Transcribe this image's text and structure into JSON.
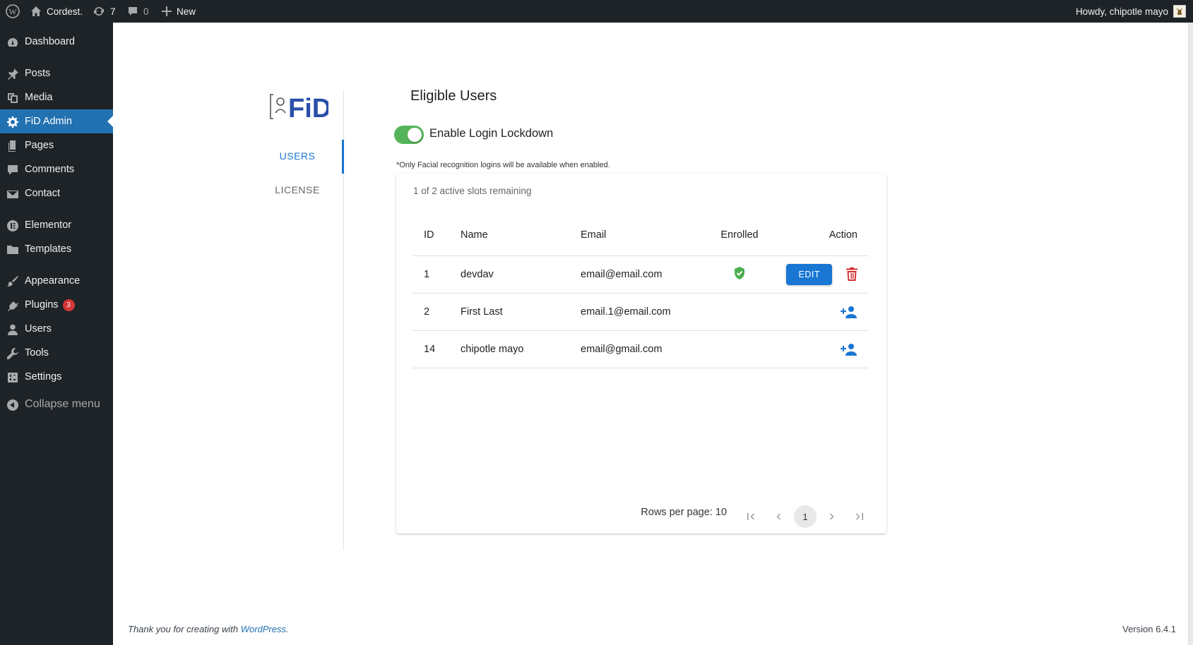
{
  "adminbar": {
    "site_name": "Cordest.",
    "updates_count": "7",
    "comments_count": "0",
    "new_label": "New",
    "greeting": "Howdy, chipotle mayo"
  },
  "sidebar": {
    "items": [
      {
        "label": "Dashboard",
        "icon": "dashboard-icon"
      },
      {
        "label": "Posts",
        "icon": "pin-icon"
      },
      {
        "label": "Media",
        "icon": "media-icon"
      },
      {
        "label": "FiD Admin",
        "icon": "gear-icon",
        "active": true
      },
      {
        "label": "Pages",
        "icon": "page-icon"
      },
      {
        "label": "Comments",
        "icon": "comment-icon"
      },
      {
        "label": "Contact",
        "icon": "mail-icon"
      },
      {
        "label": "Elementor",
        "icon": "elementor-icon"
      },
      {
        "label": "Templates",
        "icon": "folder-icon"
      },
      {
        "label": "Appearance",
        "icon": "brush-icon"
      },
      {
        "label": "Plugins",
        "icon": "plug-icon",
        "badge": "3"
      },
      {
        "label": "Users",
        "icon": "user-icon"
      },
      {
        "label": "Tools",
        "icon": "wrench-icon"
      },
      {
        "label": "Settings",
        "icon": "settings-icon"
      }
    ],
    "collapse_label": "Collapse menu"
  },
  "fid": {
    "logo_text": "FiD",
    "nav": {
      "users": "USERS",
      "license": "LICENSE"
    },
    "title": "Eligible Users",
    "toggle_label": "Enable Login Lockdown",
    "toggle_on": true,
    "note": "*Only Facial recognition logins will be available when enabled.",
    "slots_text": "1 of 2 active slots remaining",
    "columns": {
      "id": "ID",
      "name": "Name",
      "email": "Email",
      "enrolled": "Enrolled",
      "action": "Action"
    },
    "rows": [
      {
        "id": "1",
        "name": "devdav",
        "email": "email@email.com",
        "enrolled": true,
        "edit_label": "EDIT"
      },
      {
        "id": "2",
        "name": "First Last",
        "email": "email.1@email.com",
        "enrolled": false
      },
      {
        "id": "14",
        "name": "chipotle mayo",
        "email": "email@gmail.com",
        "enrolled": false
      }
    ],
    "pagination": {
      "rows_per_page_label": "Rows per page: 10",
      "current_page": "1"
    }
  },
  "footer": {
    "thanks_prefix": "Thank you for creating with ",
    "thanks_link": "WordPress",
    "thanks_suffix": ".",
    "version": "Version 6.4.1"
  },
  "colors": {
    "accent": "#1976d2",
    "wp_blue": "#2271b1",
    "toggle_green": "#55b45a",
    "danger": "#d32f2f",
    "enrolled_green": "#4caf50"
  }
}
